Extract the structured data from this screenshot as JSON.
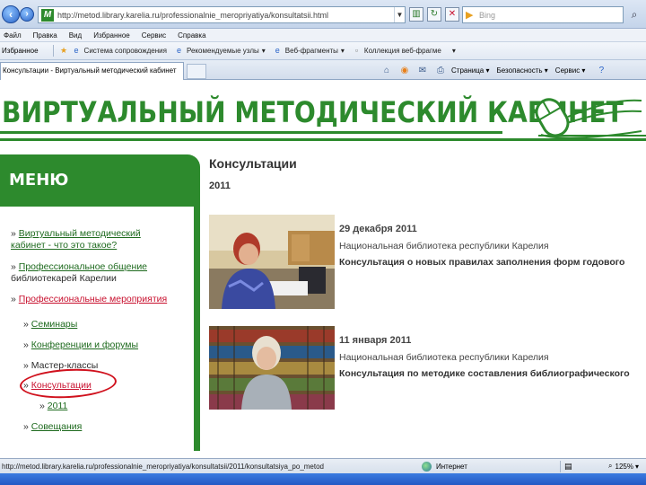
{
  "browser": {
    "address_url": "http://metod.library.karelia.ru/professionalnie_meropriyatiya/konsultatsii.html",
    "search_placeholder": "Bing",
    "menu": [
      "Файл",
      "Правка",
      "Вид",
      "Избранное",
      "Сервис",
      "Справка"
    ],
    "favorites_label": "Избранное",
    "favorites": [
      "Система сопровождения",
      "Рекомендуемые узлы",
      "Веб-фрагменты",
      "Коллекция веб-фрагме"
    ],
    "active_tab": "Консультации - Виртуальный методический кабинет",
    "commands": [
      "Страница",
      "Безопасность",
      "Сервис"
    ],
    "status_url": "http://metod.library.karelia.ru/professionalnie_meropriyatiya/konsultatsii/2011/konsultatsiya_po_metod",
    "status_zone": "Интернет",
    "zoom": "125%"
  },
  "site": {
    "banner_title": "ВИРТУАЛЬНЫЙ МЕТОДИЧЕСКИЙ КАБИНЕТ",
    "menu_header": "МЕНЮ",
    "sidebar": {
      "item1_line1": "Виртуальный методический",
      "item1_line2": "кабинет - что это такое?",
      "item2_line1": "Профессиональное общение",
      "item2_line2": "библиотекарей Карелии",
      "item3": "Профессиональные мероприятия",
      "sub1": "Семинары",
      "sub2": "Конференции и форумы",
      "sub3": "Мастер-классы",
      "sub4": "Консультации",
      "subsub1": "2011",
      "sub5": "Совещания"
    },
    "content_title": "Консультации",
    "content_year": "2011",
    "news": [
      {
        "date": "29 декабря 2011",
        "org": "Национальная библиотека республики Карелия",
        "title": "Консультация о новых правилах заполнения форм годового"
      },
      {
        "date": "11 января 2011",
        "org": "Национальная библиотека республики Карелия",
        "title": "Консультация по методике составления библиографического"
      }
    ]
  },
  "colors": {
    "brand_green": "#2d8a2d",
    "active_red": "#c8102e",
    "annotation_circle": "#d0111d"
  }
}
